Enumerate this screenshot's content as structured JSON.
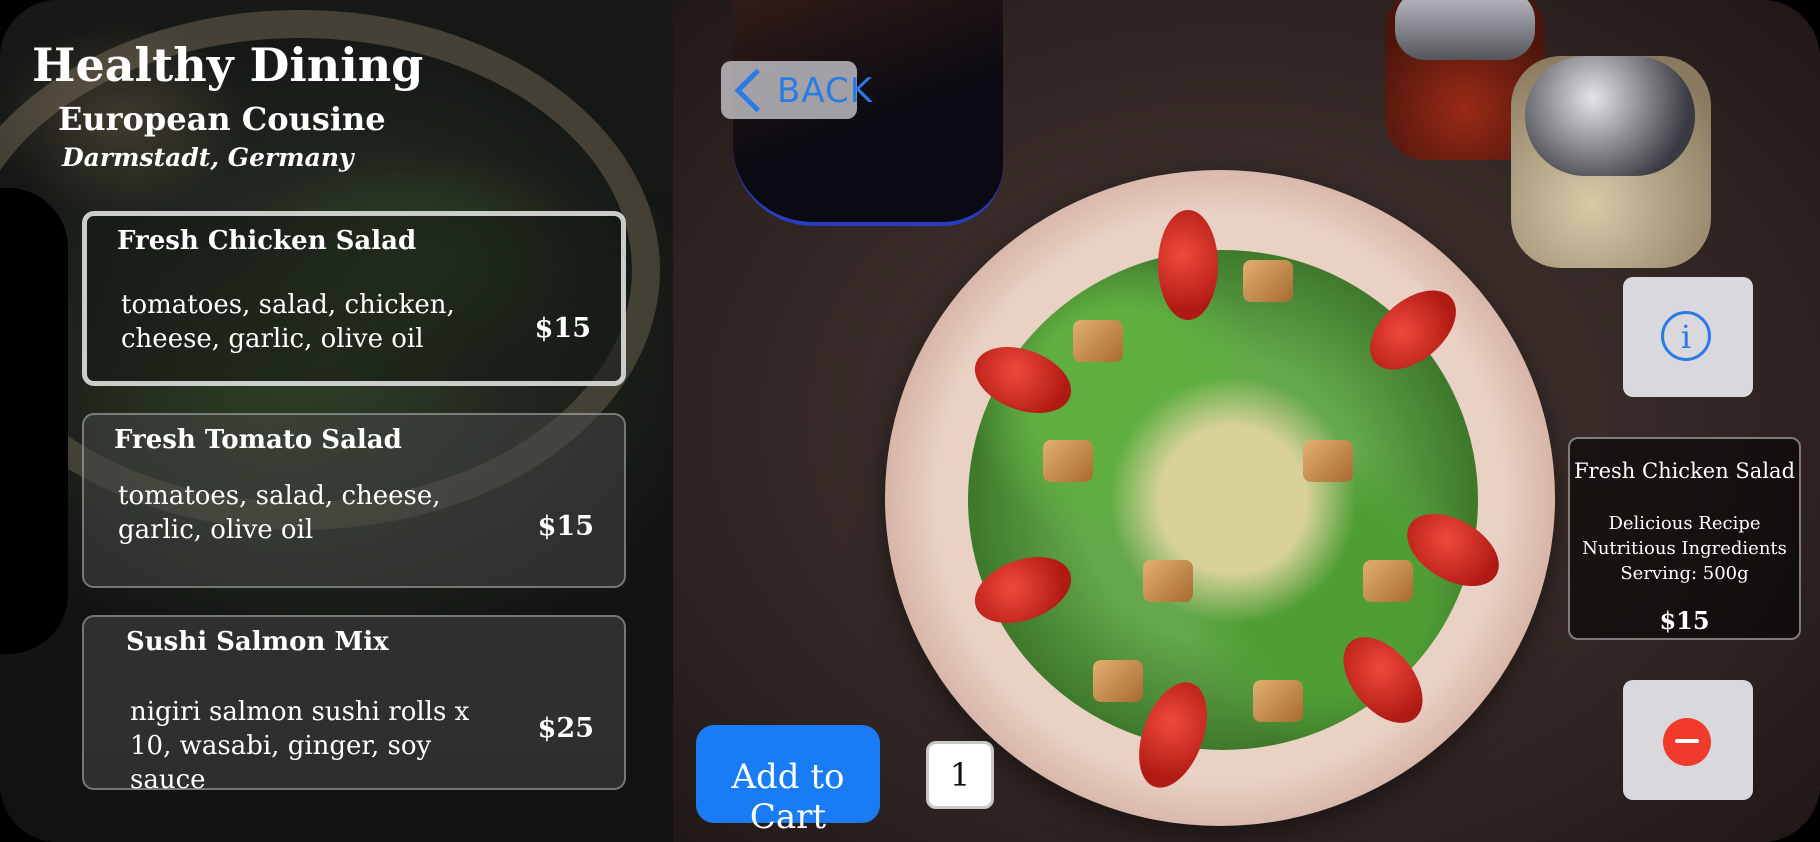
{
  "restaurant": {
    "title": "Healthy Dining",
    "subtitle": "European Cousine",
    "location": "Darmstadt, Germany"
  },
  "menu": {
    "items": [
      {
        "name": "Fresh Chicken Salad",
        "description": "tomatoes, salad, chicken, cheese, garlic, olive oil",
        "price": "$15",
        "selected": true
      },
      {
        "name": "Fresh Tomato Salad",
        "description": "tomatoes, salad, cheese, garlic, olive oil",
        "price": "$15",
        "selected": false
      },
      {
        "name": "Sushi Salmon Mix",
        "description": "nigiri salmon sushi rolls x 10, wasabi, ginger, soy sauce",
        "price": "$25",
        "selected": false
      }
    ]
  },
  "toolbar": {
    "back_label": "BACK",
    "info_icon": "info-icon",
    "remove_icon": "minus-circle-icon"
  },
  "detail": {
    "name": "Fresh Chicken Salad",
    "line1": "Delicious Recipe",
    "line2": "Nutritious Ingredients",
    "line3": "Serving: 500g",
    "price": "$15"
  },
  "cart": {
    "add_label": "Add to Cart",
    "quantity": "1"
  },
  "colors": {
    "accent": "#1a7cf5",
    "link": "#2b7be6",
    "danger": "#f03a2c"
  }
}
